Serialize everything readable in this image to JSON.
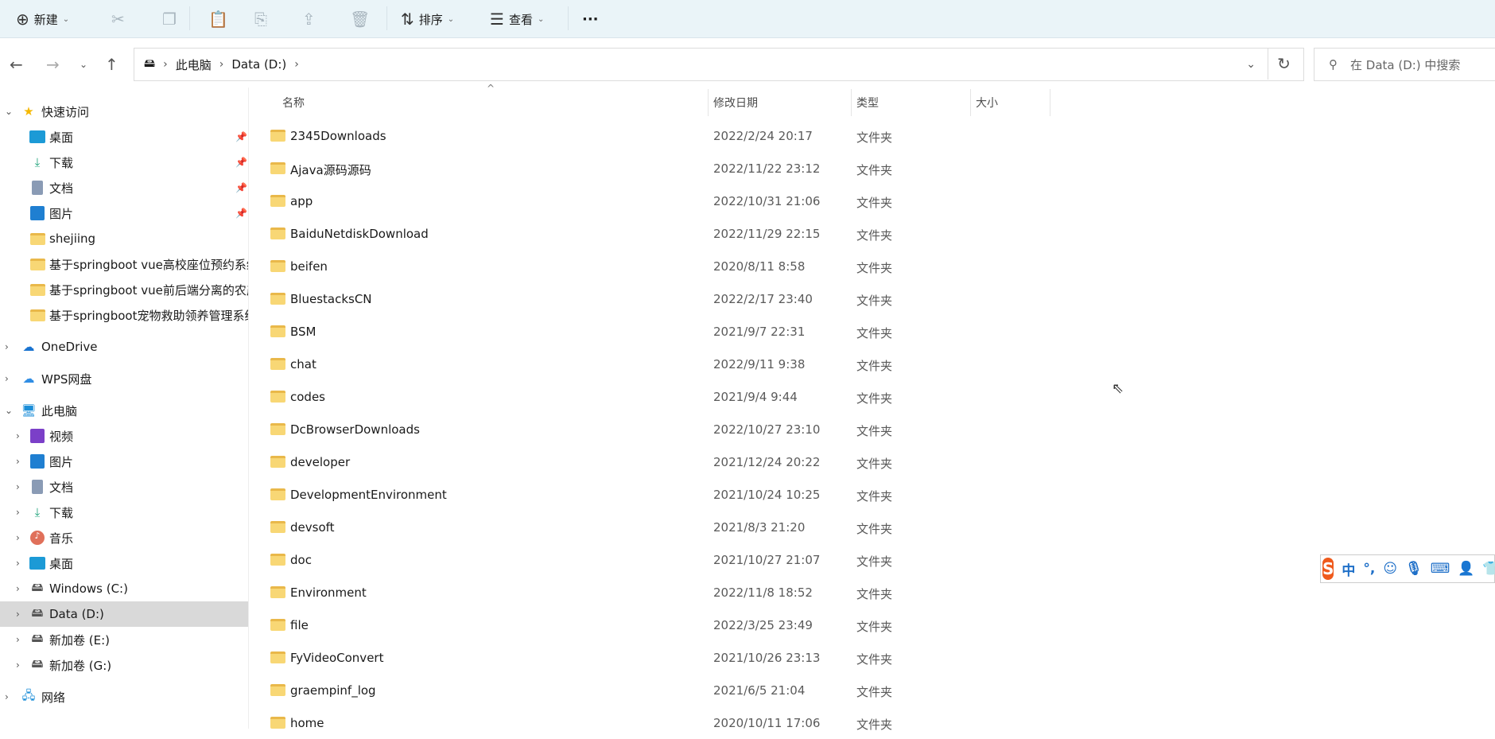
{
  "toolbar": {
    "new": "新建",
    "sort": "排序",
    "view": "查看",
    "more": "···"
  },
  "address": {
    "crumbs": [
      "此电脑",
      "Data (D:)"
    ]
  },
  "search": {
    "placeholder": "在 Data (D:) 中搜索"
  },
  "sidebar": {
    "quick_access": "快速访问",
    "quick_items": [
      "桌面",
      "下载",
      "文档",
      "图片",
      "shejiing",
      "基于springboot vue高校座位预约系统",
      "基于springboot vue前后端分离的农产",
      "基于springboot宠物救助领养管理系统"
    ],
    "onedrive": "OneDrive",
    "wps": "WPS网盘",
    "this_pc": "此电脑",
    "pc_items": [
      "视频",
      "图片",
      "文档",
      "下载",
      "音乐",
      "桌面",
      "Windows (C:)",
      "Data (D:)",
      "新加卷 (E:)",
      "新加卷 (G:)"
    ],
    "network": "网络"
  },
  "columns": {
    "name": "名称",
    "date": "修改日期",
    "type": "类型",
    "size": "大小"
  },
  "files": [
    {
      "name": "2345Downloads",
      "date": "2022/2/24 20:17",
      "type": "文件夹"
    },
    {
      "name": "Ajava源码源码",
      "date": "2022/11/22 23:12",
      "type": "文件夹"
    },
    {
      "name": "app",
      "date": "2022/10/31 21:06",
      "type": "文件夹"
    },
    {
      "name": "BaiduNetdiskDownload",
      "date": "2022/11/29 22:15",
      "type": "文件夹"
    },
    {
      "name": "beifen",
      "date": "2020/8/11 8:58",
      "type": "文件夹"
    },
    {
      "name": "BluestacksCN",
      "date": "2022/2/17 23:40",
      "type": "文件夹"
    },
    {
      "name": "BSM",
      "date": "2021/9/7 22:31",
      "type": "文件夹"
    },
    {
      "name": "chat",
      "date": "2022/9/11 9:38",
      "type": "文件夹"
    },
    {
      "name": "codes",
      "date": "2021/9/4 9:44",
      "type": "文件夹"
    },
    {
      "name": "DcBrowserDownloads",
      "date": "2022/10/27 23:10",
      "type": "文件夹"
    },
    {
      "name": "developer",
      "date": "2021/12/24 20:22",
      "type": "文件夹"
    },
    {
      "name": "DevelopmentEnvironment",
      "date": "2021/10/24 10:25",
      "type": "文件夹"
    },
    {
      "name": "devsoft",
      "date": "2021/8/3 21:20",
      "type": "文件夹"
    },
    {
      "name": "doc",
      "date": "2021/10/27 21:07",
      "type": "文件夹"
    },
    {
      "name": "Environment",
      "date": "2022/11/8 18:52",
      "type": "文件夹"
    },
    {
      "name": "file",
      "date": "2022/3/25 23:49",
      "type": "文件夹"
    },
    {
      "name": "FyVideoConvert",
      "date": "2021/10/26 23:13",
      "type": "文件夹"
    },
    {
      "name": "graempinf_log",
      "date": "2021/6/5 21:04",
      "type": "文件夹"
    },
    {
      "name": "home",
      "date": "2020/10/11 17:06",
      "type": "文件夹"
    }
  ],
  "ime": {
    "logo": "S",
    "mode": "中",
    "punct": "°,"
  }
}
